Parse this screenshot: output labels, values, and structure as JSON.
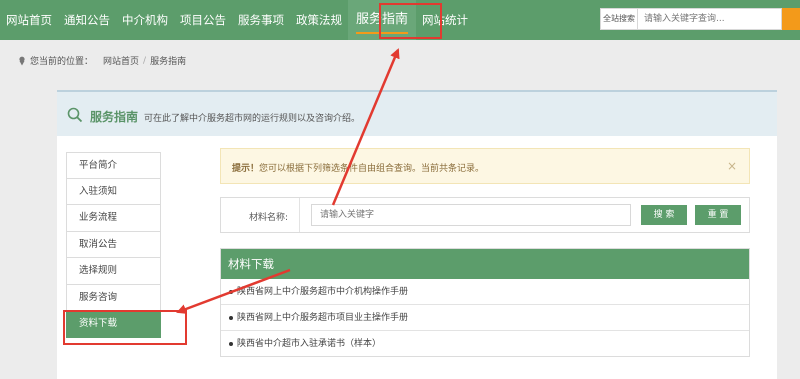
{
  "nav": {
    "items": [
      "网站首页",
      "通知公告",
      "中介机构",
      "项目公告",
      "服务事项",
      "政策法规",
      "服务指南",
      "网站统计"
    ],
    "active": "服务指南"
  },
  "search": {
    "scope": "全站搜索",
    "placeholder": "请输入关键字查询..."
  },
  "breadcrumb": {
    "prefix": "您当前的位置：",
    "home": "网站首页",
    "sep": "/",
    "current": "服务指南"
  },
  "panel": {
    "title": "服务指南",
    "description": "可在此了解中介服务超市网的运行规则以及咨询介绍。"
  },
  "sidebar": {
    "items": [
      "平台简介",
      "入驻须知",
      "业务流程",
      "取消公告",
      "选择规则",
      "服务咨询",
      "资料下载"
    ],
    "active": "资料下载"
  },
  "alert": {
    "strong": "提示！",
    "text": "您可以根据下列筛选条件自由组合查询。当前共条记录。",
    "close": "×"
  },
  "filter": {
    "label": "材料名称:",
    "placeholder": "请输入关键字",
    "search_btn": "搜 索",
    "reset_btn": "重 置"
  },
  "downloads": {
    "title": "材料下载",
    "items": [
      "陕西省网上中介服务超市中介机构操作手册",
      "陕西省网上中介服务超市项目业主操作手册",
      "陕西省中介超市入驻承诺书（样本）"
    ]
  },
  "colors": {
    "primary": "#5c9d6b",
    "accent": "#f39a1a",
    "annotation": "#e23a30"
  }
}
